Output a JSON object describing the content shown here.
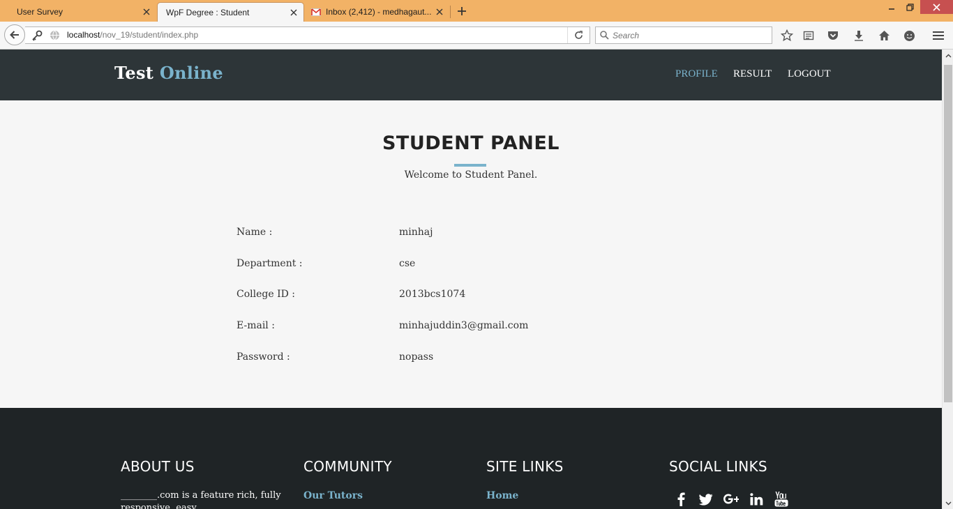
{
  "browser": {
    "tabs": [
      {
        "label": "User Survey",
        "active": false
      },
      {
        "label": "WpF Degree : Student",
        "active": true
      },
      {
        "label": "Inbox (2,412) - medhagaut...",
        "active": false
      }
    ],
    "url": {
      "host": "localhost",
      "path": "/nov_19/student/index.php"
    },
    "search_placeholder": "Search"
  },
  "site": {
    "logo_main": "Test",
    "logo_accent": "Online",
    "nav": [
      {
        "label": "PROFILE",
        "active": true
      },
      {
        "label": "RESULT",
        "active": false
      },
      {
        "label": "LOGOUT",
        "active": false
      }
    ]
  },
  "panel": {
    "title": "STUDENT PANEL",
    "subtitle": "Welcome to Student Panel.",
    "fields": [
      {
        "label": "Name :",
        "value": "minhaj"
      },
      {
        "label": "Department :",
        "value": "cse"
      },
      {
        "label": "College ID :",
        "value": "2013bcs1074"
      },
      {
        "label": "E-mail :",
        "value": "minhajuddin3@gmail.com"
      },
      {
        "label": "Password :",
        "value": "nopass"
      }
    ]
  },
  "footer": {
    "about": {
      "title": "ABOUT US",
      "text": "________.com is a feature rich, fully responsive, easy"
    },
    "community": {
      "title": "COMMUNITY",
      "first_link": "Our Tutors"
    },
    "site_links": {
      "title": "SITE LINKS",
      "first_link": "Home"
    },
    "social": {
      "title": "SOCIAL LINKS",
      "icons": [
        "facebook-icon",
        "twitter-icon",
        "google-plus-icon",
        "linkedin-icon",
        "youtube-icon"
      ]
    }
  },
  "colors": {
    "accent": "#7ab3cc",
    "header_bg": "#2d3538",
    "footer_bg": "#1f2426",
    "tabbar_bg": "#f2b266"
  }
}
